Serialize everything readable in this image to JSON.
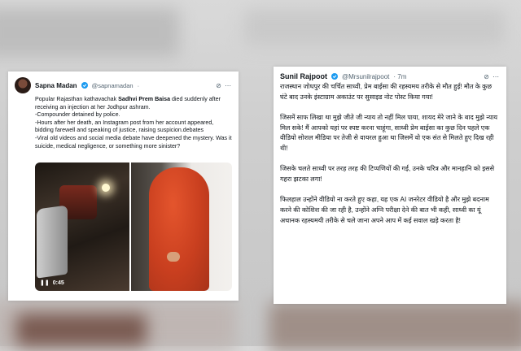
{
  "left_tweet": {
    "author_name": "Sapna Madan",
    "handle": "@sapnamadan",
    "dot": "·",
    "grok_icon": "grok-slash-icon",
    "text_pre": "Popular Rajasthan kathavachak ",
    "text_bold": "Sadhvi Prem Baisa",
    "text_post": " died suddenly after receiving an injection at her Jodhpur ashram.",
    "bullets": [
      "-Compounder detained by police.",
      "-Hours after her death, an Instagram post from her account appeared, bidding farewell and speaking of justice, raising suspicion.debates",
      "-Viral old videos and social media debate have deepened the mystery. Was it suicide, medical negligence, or something more sinister?"
    ],
    "video_time": "0:45",
    "verified_color": "#1d9bf0"
  },
  "right_tweet": {
    "author_name": "Sunil Rajpoot",
    "handle": "@Mrsunilrajpoot",
    "time": "· 7m",
    "grok_icon": "grok-slash-icon",
    "paragraphs": [
      "राजस्थान जोधपुर की चर्चित साध्वी, प्रेम बाईसा की रहस्यमय तरीके से मौत हुई! मौत के कुछ घंटे बाद उनके इंस्टाग्राम अकाउंट पर सुसाइड नोट पोस्ट किया गया!",
      "जिसमें साफ लिखा था मुझे जीते जी न्याय तो नहीं मिल पाया, शायद मेरे जाने के बाद मुझे न्याय मिल सके! मैं आपको यहां पर स्पष्ट करना चाहूंगा, साध्वी प्रेम बाईसा का कुछ दिन पहले एक वीडियो सोशल मीडिया पर तेजी से वायरल हुआ था जिसमें वो एक संत से मिलते हुए दिख रही थी!",
      "जिसके चलते साध्वी पर तरह तरह की टिप्पणियों की गई, उनके चरित्र और मानहानि को इससे गहरा झटका लगा!",
      "फिलहाल उन्होंने वीडियो ना करते हुए कहा, यह एक AI जनरेटर वीडियो है और मुझे बदनाम करने की कोशिश की जा रही है, उन्होंने अग्नि परीक्षा देने की बात भी कही, साध्वी का यूं अचानक रहस्यमयी तरीके से चले जाना अपने आप में कई सवाल खड़े करता है!"
    ],
    "verified_color": "#1d9bf0"
  }
}
